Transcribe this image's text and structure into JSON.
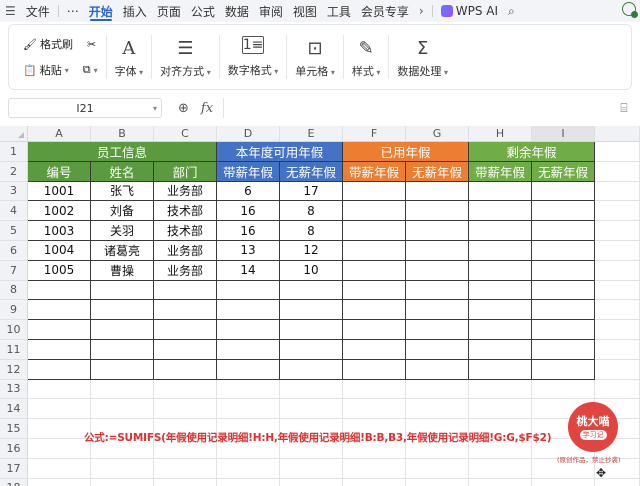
{
  "menu": {
    "items": [
      "文件",
      "⋯",
      "开始",
      "插入",
      "页面",
      "公式",
      "数据",
      "审阅",
      "视图",
      "工具",
      "会员专享"
    ],
    "active_index": 2,
    "wps_ai": "WPS AI"
  },
  "ribbon": {
    "format_painter": "格式刷",
    "paste": "粘贴",
    "font": "字体",
    "align": "对齐方式",
    "number_format": "数字格式",
    "cell": "单元格",
    "style": "样式",
    "data_processing": "数据处理"
  },
  "formula_bar": {
    "name_box": "I21",
    "fx": "fx",
    "value": ""
  },
  "sheet": {
    "columns": [
      "A",
      "B",
      "C",
      "D",
      "E",
      "F",
      "G",
      "H",
      "I"
    ],
    "selected_column": "I",
    "rows": [
      "1",
      "2",
      "3",
      "4",
      "5",
      "6",
      "7",
      "8",
      "9",
      "10",
      "11",
      "12",
      "13",
      "14",
      "15",
      "16",
      "17",
      "18"
    ],
    "group_headers": {
      "employee_info": "员工信息",
      "available_leave": "本年度可用年假",
      "used_leave": "已用年假",
      "remaining_leave": "剩余年假"
    },
    "sub_headers": [
      "编号",
      "姓名",
      "部门",
      "带薪年假",
      "无薪年假",
      "带薪年假",
      "无薪年假",
      "带薪年假",
      "无薪年假"
    ],
    "records": [
      [
        "1001",
        "张飞",
        "业务部",
        "6",
        "17"
      ],
      [
        "1002",
        "刘备",
        "技术部",
        "16",
        "8"
      ],
      [
        "1003",
        "关羽",
        "技术部",
        "16",
        "8"
      ],
      [
        "1004",
        "诸葛亮",
        "业务部",
        "13",
        "12"
      ],
      [
        "1005",
        "曹操",
        "业务部",
        "14",
        "10"
      ]
    ],
    "formula_note": "公式:=SUMIFS(年假使用记录明细!H:H,年假使用记录明细!B:B,B3,年假使用记录明细!G:G,$F$2)"
  },
  "watermark": {
    "name": "桃大喵",
    "tag": "学习记",
    "note": "(原创作品，禁止抄袭)"
  },
  "colors": {
    "green": "#5b9a3e",
    "blue": "#4472c4",
    "orange": "#ed7d31",
    "light_green": "#70ad47",
    "accent": "#2a64c9",
    "note_red": "#e0302f"
  }
}
